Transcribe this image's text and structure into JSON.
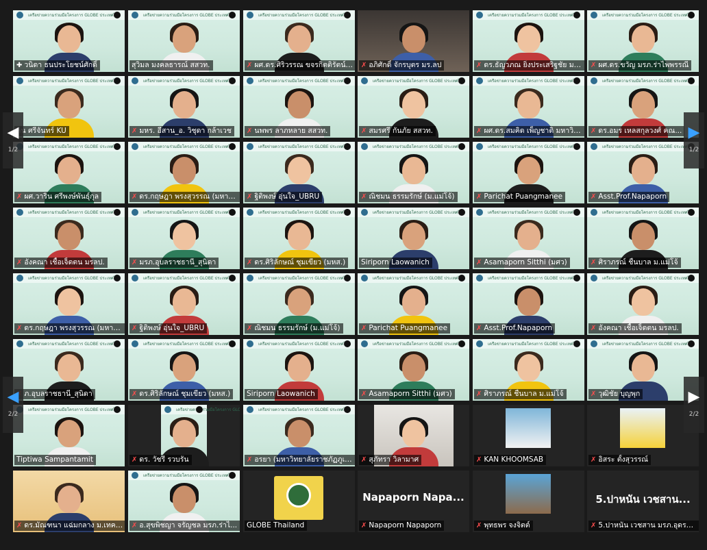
{
  "meeting": {
    "banner_text": "เครือข่ายความร่วมมือโครงการ GLOBE ประเทศไทย",
    "accent_color": "#e6f23a",
    "mute_icon": "muted-mic-icon",
    "speaking_icon": "mic-icon"
  },
  "nav": {
    "left_label": "1/2",
    "right_label": "1/2",
    "left2_label": "2/2",
    "right2_label": "2/2"
  },
  "participants": [
    {
      "name": "วนิดา ธนประโยชน์ศักดิ์",
      "muted": false,
      "active": true,
      "kind": "green"
    },
    {
      "name": "สุวิมล มงคลธารณ์ สสวท.",
      "muted": false,
      "kind": "green"
    },
    {
      "name": "ผศ.ดร.ศิริวรรณ ขจรกิตติรัตน์ (...",
      "muted": true,
      "kind": "green"
    },
    {
      "name": "อภิศักดิ์ จักรบุตร มร.ลป",
      "muted": true,
      "kind": "room"
    },
    {
      "name": "ดร.ธัญวภณ ยิ่งประเสริฐชัย มร...",
      "muted": true,
      "kind": "green"
    },
    {
      "name": "ผศ.ดร.ขวัญ มรภ.ร่าไพพรรณี",
      "muted": true,
      "kind": "green"
    },
    {
      "name": "ลิน ศรีจันทร์ KU",
      "muted": false,
      "kind": "green"
    },
    {
      "name": "มหร. อีสาน_อ. วิชุดา กล้าเวช",
      "muted": true,
      "kind": "green"
    },
    {
      "name": "นพพร ลาภหลาย สสวท.",
      "muted": true,
      "kind": "green"
    },
    {
      "name": "สมรศรี กันภัย สสวท.",
      "muted": true,
      "kind": "green"
    },
    {
      "name": "ผศ.ดร.สมคิด เพ็ญชาติ มหาวิท...",
      "muted": true,
      "kind": "green"
    },
    {
      "name": "ดร.อมร เหลสกุลวงศ์ คณ...",
      "muted": true,
      "kind": "green"
    },
    {
      "name": "ผศ.วาริน ศรีพงษ์พันธุ์กุล",
      "muted": true,
      "kind": "green"
    },
    {
      "name": "ดร.กฤษฎา พรงสุวรรณ (มหาวิ...",
      "muted": true,
      "kind": "green"
    },
    {
      "name": "ฐิติพงษ์ อุ่นใจ_UBRU",
      "muted": true,
      "kind": "green"
    },
    {
      "name": "ณิชมน ธรรมรักษ์ (ม.แม่โจ้)",
      "muted": true,
      "kind": "green"
    },
    {
      "name": "Parichat Puangmanee",
      "muted": true,
      "kind": "green"
    },
    {
      "name": "Asst.Prof.Napaporn",
      "muted": true,
      "kind": "green"
    },
    {
      "name": "อังคณา เชื้อเจ็ดตน มรลป.",
      "muted": true,
      "kind": "green"
    },
    {
      "name": "มรภ.อุบลราชธานี_สุนิดา",
      "muted": true,
      "kind": "green"
    },
    {
      "name": "ดร.ศิริลักษณ์ ชุมเขียว (มหส.)",
      "muted": true,
      "kind": "green"
    },
    {
      "name": "Siriporn Laowanich",
      "muted": false,
      "kind": "green"
    },
    {
      "name": "Asamaporn Sitthi (มศว)",
      "muted": true,
      "kind": "green"
    },
    {
      "name": "ศิราภรณ์ ชื่นบาล ม.แม่โจ้",
      "muted": true,
      "kind": "green"
    },
    {
      "name": "ดร.กฤษฎา พรงสุวรรณ (มหาวิ...",
      "muted": true,
      "kind": "green"
    },
    {
      "name": "ฐิติพงษ์ อุ่นใจ_UBRU",
      "muted": true,
      "kind": "green"
    },
    {
      "name": "ณิชมน ธรรมรักษ์ (ม.แม่โจ้)",
      "muted": true,
      "kind": "green"
    },
    {
      "name": "Parichat Puangmanee",
      "muted": true,
      "kind": "green"
    },
    {
      "name": "Asst.Prof.Napaporn",
      "muted": true,
      "kind": "green"
    },
    {
      "name": "อังคณา เชื้อเจ็ดตน มรลป.",
      "muted": true,
      "kind": "green"
    },
    {
      "name": "ภ.อุบลราชธานี_สุนิดา",
      "muted": true,
      "kind": "green"
    },
    {
      "name": "ดร.ศิริลักษณ์ ชุมเขียว (มหส.)",
      "muted": true,
      "kind": "green"
    },
    {
      "name": "Siriporn Laowanich",
      "muted": false,
      "kind": "green"
    },
    {
      "name": "Asamaporn Sitthi (มศว)",
      "muted": true,
      "kind": "green"
    },
    {
      "name": "ศิราภรณ์ ชื่นบาล ม.แม่โจ้",
      "muted": true,
      "kind": "green"
    },
    {
      "name": "วุฒิชัย บุญพุก",
      "muted": true,
      "kind": "green"
    },
    {
      "name": "Tiptiwa Sampantamit",
      "muted": false,
      "kind": "green"
    },
    {
      "name": "ดร. วัชรี รวบรัน",
      "muted": true,
      "kind": "narrow"
    },
    {
      "name": "อรยา (มหาวิทยาลัยราชภัฏภูเก...",
      "muted": true,
      "kind": "green"
    },
    {
      "name": "สุภัทรา วิลามาศ",
      "muted": true,
      "kind": "office"
    },
    {
      "name": "KAN KHOOMSAB",
      "muted": true,
      "kind": "photo"
    },
    {
      "name": "อิสระ ตั้งสุวรรณ์",
      "muted": true,
      "kind": "photo2"
    },
    {
      "name": "ดร.มัณฑนา แฉ่มกลาง ม.เทคโ...",
      "muted": true,
      "kind": "science"
    },
    {
      "name": "อ.สุขพิชญา จรัญชล มรภ.ร่าไ...",
      "muted": true,
      "kind": "green"
    },
    {
      "name": "GLOBE Thailand",
      "muted": false,
      "kind": "logo"
    },
    {
      "name": "Napaporn Napaporn",
      "muted": true,
      "kind": "text",
      "big": "Napaporn  Napa..."
    },
    {
      "name": "พุทธพร จงจิตต์",
      "muted": true,
      "kind": "photo3"
    },
    {
      "name": "5.ปาหนัน เวชสาน มรภ.อุดรธานี",
      "muted": true,
      "kind": "text",
      "big": "5.ปาหนัน  เวชสาน..."
    }
  ]
}
